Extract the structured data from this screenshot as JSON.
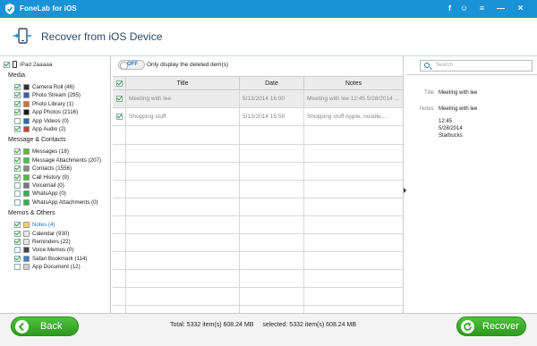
{
  "app": {
    "title": "FoneLab for iOS",
    "header_title": "Recover from iOS Device",
    "accent": "#1a92d8",
    "brand_green": "#3aae2b"
  },
  "titlebar_buttons": [
    {
      "icon": "facebook-icon",
      "glyph": "f"
    },
    {
      "icon": "chat-icon",
      "glyph": "☺"
    },
    {
      "icon": "menu-icon",
      "glyph": "≡"
    },
    {
      "icon": "minimize-icon",
      "glyph": "—"
    },
    {
      "icon": "close-icon",
      "glyph": "×"
    }
  ],
  "sidebar": {
    "device_name": "iPad 2aaaaa",
    "groups": [
      {
        "label": "Media",
        "items": [
          {
            "label": "Camera Roll (46)",
            "icon": "camera-icon",
            "color": "#333333",
            "checked": true
          },
          {
            "label": "Photo Stream (295)",
            "icon": "photo-stream-icon",
            "color": "#3b5fa8",
            "checked": true
          },
          {
            "label": "Photo Library (1)",
            "icon": "photo-library-icon",
            "color": "#e0692c",
            "checked": true
          },
          {
            "label": "App Photos (2116)",
            "icon": "app-photos-icon",
            "color": "#1c1c1c",
            "checked": true
          },
          {
            "label": "App Videos (0)",
            "icon": "app-videos-icon",
            "color": "#2d68b0",
            "checked": false
          },
          {
            "label": "App Audio (2)",
            "icon": "app-audio-icon",
            "color": "#d63a3a",
            "checked": true
          }
        ]
      },
      {
        "label": "Message & Contacts",
        "items": [
          {
            "label": "Messages (18)",
            "icon": "messages-icon",
            "color": "#4cc23b",
            "checked": true
          },
          {
            "label": "Message Attachments (207)",
            "icon": "message-attachments-icon",
            "color": "#4cc23b",
            "checked": true
          },
          {
            "label": "Contacts (1556)",
            "icon": "contacts-icon",
            "color": "#8a8a8a",
            "checked": true
          },
          {
            "label": "Call History (9)",
            "icon": "call-history-icon",
            "color": "#4cc23b",
            "checked": true
          },
          {
            "label": "Voicemail (0)",
            "icon": "voicemail-icon",
            "color": "#777777",
            "checked": false
          },
          {
            "label": "WhatsApp (0)",
            "icon": "whatsapp-icon",
            "color": "#2fb44a",
            "checked": false
          },
          {
            "label": "WhatsApp Attachments (0)",
            "icon": "whatsapp-attachments-icon",
            "color": "#2fb44a",
            "checked": false
          }
        ]
      },
      {
        "label": "Memos & Others",
        "items": [
          {
            "label": "Notes (4)",
            "icon": "notes-icon",
            "color": "#f2d35a",
            "checked": true,
            "selected": true
          },
          {
            "label": "Calendar (930)",
            "icon": "calendar-icon",
            "color": "#e8e8e8",
            "checked": true
          },
          {
            "label": "Reminders (22)",
            "icon": "reminders-icon",
            "color": "#e8e8e8",
            "checked": true
          },
          {
            "label": "Voice Memos (0)",
            "icon": "voice-memos-icon",
            "color": "#444444",
            "checked": false
          },
          {
            "label": "Safari Bookmark (114)",
            "icon": "safari-icon",
            "color": "#3a7fd0",
            "checked": true
          },
          {
            "label": "App Document (12)",
            "icon": "app-document-icon",
            "color": "#d0d0d0",
            "checked": false
          }
        ]
      }
    ]
  },
  "filter": {
    "toggle_label": "OFF",
    "toggle_on": false,
    "description": "Only display the deleted item(s)"
  },
  "table": {
    "columns": [
      "Title",
      "Date",
      "Notes"
    ],
    "rows": [
      {
        "title": "Meeting with lee",
        "date": "5/13/2014 16:00",
        "notes": "Meeting with lee  12:45 5/28/2014 ...",
        "checked": true
      },
      {
        "title": "Shopping stuff",
        "date": "5/13/2014 15:59",
        "notes": "Shopping stuff  Apple, noodle,...",
        "checked": true
      }
    ]
  },
  "search": {
    "placeholder": "Search"
  },
  "detail": {
    "title_label": "Title",
    "title_value": "Meeting with lee",
    "notes_label": "Notes",
    "notes_lines": [
      "Meeting with lee",
      "12:45",
      "5/28/2014",
      "Starbucks"
    ]
  },
  "footer": {
    "back_label": "Back",
    "recover_label": "Recover",
    "total_text": "Total: 5332 item(s) 608.24 MB",
    "selected_text": "selected: 5332 item(s) 608.24 MB"
  }
}
